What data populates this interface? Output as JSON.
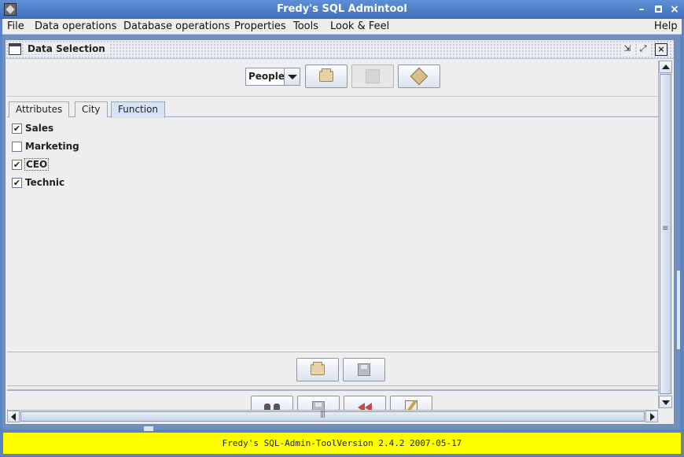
{
  "window": {
    "title": "Fredy's SQL Admintool",
    "controls": {
      "minimize": "–",
      "close": "×"
    }
  },
  "menubar": {
    "items": [
      "File",
      "Data operations",
      "Database operations",
      "Properties",
      "Tools",
      "Look & Feel"
    ],
    "help": "Help"
  },
  "internal_frame": {
    "title": "Data Selection",
    "controls": {
      "iconify": "⇲",
      "maximize": "⤢",
      "close": "×"
    }
  },
  "toolbar": {
    "table_select": {
      "selected": "People"
    },
    "buttons": [
      {
        "icon": "open-folder-icon",
        "enabled": true
      },
      {
        "icon": "blank-icon",
        "enabled": false
      },
      {
        "icon": "package-box-icon",
        "enabled": true
      }
    ]
  },
  "tabs": [
    {
      "label": "Attributes",
      "active": false
    },
    {
      "label": "City",
      "active": false
    },
    {
      "label": "Function",
      "active": true
    }
  ],
  "function_checkboxes": [
    {
      "label": "Sales",
      "checked": true,
      "focused": false
    },
    {
      "label": "Marketing",
      "checked": false,
      "focused": false
    },
    {
      "label": "CEO",
      "checked": true,
      "focused": true
    },
    {
      "label": "Technic",
      "checked": true,
      "focused": false
    }
  ],
  "check_mark": "✔",
  "mid_buttons": [
    {
      "icon": "open-folder-icon"
    },
    {
      "icon": "save-disk-icon"
    }
  ],
  "bottom_buttons": [
    {
      "icon": "binoculars-icon"
    },
    {
      "icon": "save-disk-icon"
    },
    {
      "icon": "rewind-icon"
    },
    {
      "icon": "edit-document-icon"
    }
  ],
  "statusbar": {
    "text": "Fredy's SQL-Admin-ToolVersion 2.4.2 2007-05-17",
    "background": "#ffff00"
  }
}
